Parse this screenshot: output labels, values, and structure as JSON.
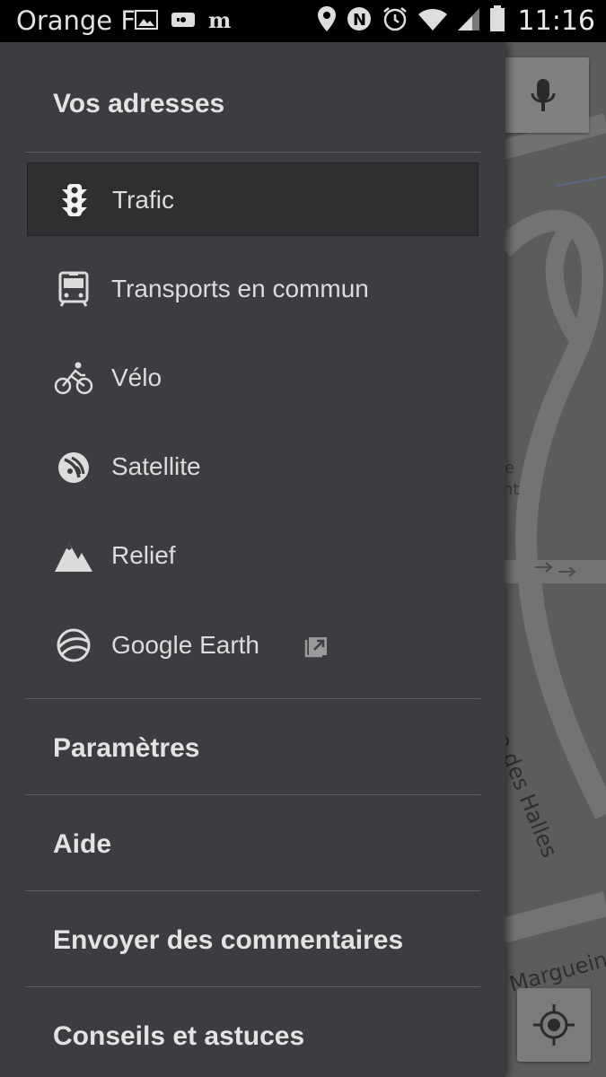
{
  "status_bar": {
    "carrier": "Orange F",
    "time": "11:16",
    "icons_left": [
      "gallery-icon",
      "voicemail-icon",
      "le-monde-icon"
    ],
    "icons_right": [
      "location-icon",
      "nfc-icon",
      "alarm-icon",
      "wifi-icon",
      "signal-icon",
      "battery-icon"
    ]
  },
  "drawer": {
    "header": "Vos adresses",
    "layers": [
      {
        "label": "Trafic",
        "icon": "traffic-light-icon",
        "selected": true
      },
      {
        "label": "Transports en commun",
        "icon": "transit-icon",
        "selected": false
      },
      {
        "label": "Vélo",
        "icon": "bike-icon",
        "selected": false
      },
      {
        "label": "Satellite",
        "icon": "satellite-icon",
        "selected": false
      },
      {
        "label": "Relief",
        "icon": "terrain-icon",
        "selected": false
      },
      {
        "label": "Google Earth",
        "icon": "earth-icon",
        "selected": false,
        "external": true
      }
    ],
    "footer_items": [
      {
        "label": "Paramètres"
      },
      {
        "label": "Aide"
      },
      {
        "label": "Envoyer des commentaires"
      },
      {
        "label": "Conseils et astuces"
      }
    ]
  },
  "map": {
    "street_labels": [
      "Rue des Halles",
      "Marguein"
    ],
    "partial_labels": [
      "e",
      "nt"
    ]
  },
  "colors": {
    "drawer_bg": "#3b3d40",
    "selected_bg": "#2d2f31",
    "text": "#dcdcdc",
    "status_bar": "#000000"
  }
}
